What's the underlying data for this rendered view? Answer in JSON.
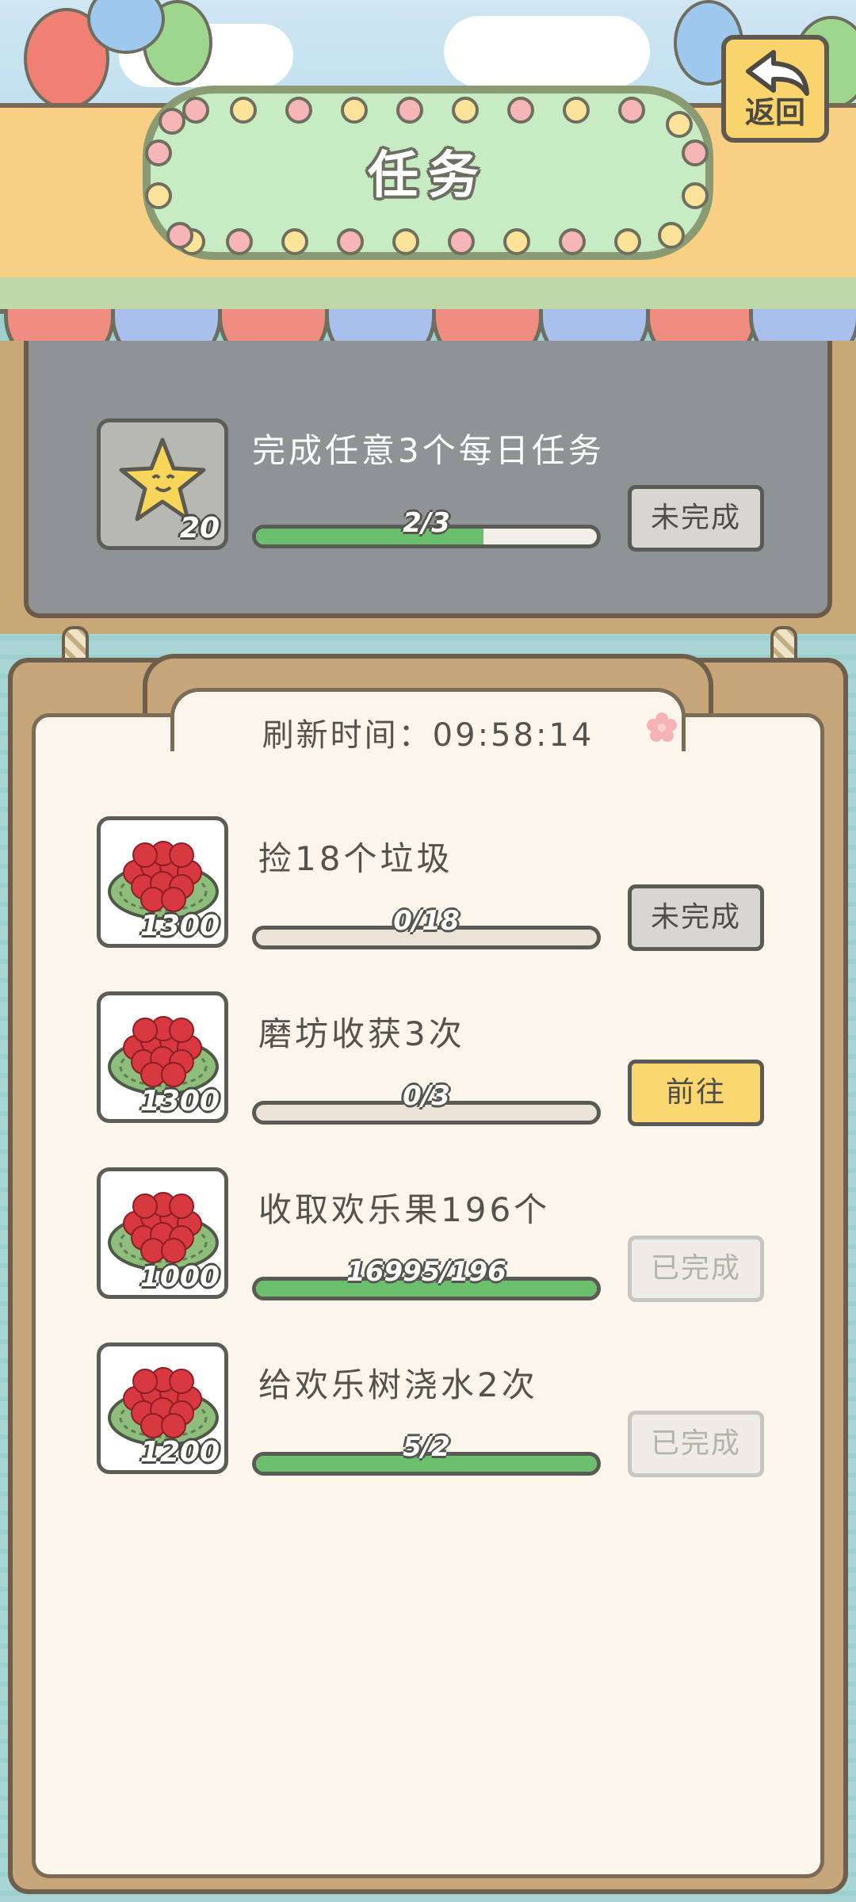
{
  "header": {
    "title": "任务",
    "back_label": "返回"
  },
  "weekly_task": {
    "name": "完成任意3个每日任务",
    "reward_icon": "star-icon",
    "reward_count": "20",
    "progress_text": "2/3",
    "progress_fraction": 0.667,
    "status": "未完成"
  },
  "board": {
    "refresh_label": "刷新时间：09:58:14"
  },
  "daily_tasks": [
    {
      "name": "捡18个垃圾",
      "reward_icon": "fruit-plate-icon",
      "reward_count": "1300",
      "progress_text": "0/18",
      "progress_fraction": 0,
      "status": "未完成",
      "state": "todo"
    },
    {
      "name": "磨坊收获3次",
      "reward_icon": "fruit-plate-icon",
      "reward_count": "1300",
      "progress_text": "0/3",
      "progress_fraction": 0,
      "status": "前往",
      "state": "go"
    },
    {
      "name": "收取欢乐果196个",
      "reward_icon": "fruit-plate-icon",
      "reward_count": "1000",
      "progress_text": "16995/196",
      "progress_fraction": 1,
      "status": "已完成",
      "state": "done"
    },
    {
      "name": "给欢乐树浇水2次",
      "reward_icon": "fruit-plate-icon",
      "reward_count": "1200",
      "progress_text": "5/2",
      "progress_fraction": 1,
      "status": "已完成",
      "state": "done"
    }
  ],
  "colors": {
    "progress_green": "#6cbf6d",
    "go_button_yellow": "#fbd772",
    "fruit_red": "#d8383f"
  }
}
